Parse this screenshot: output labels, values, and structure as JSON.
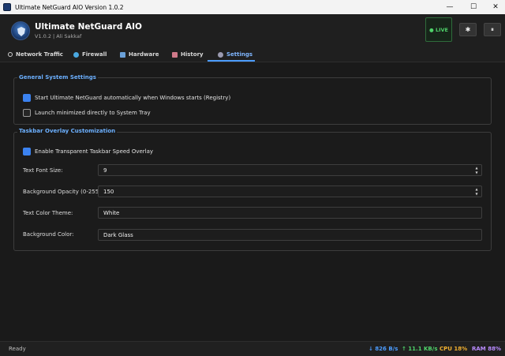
{
  "window": {
    "title": "Ultimate NetGuard AIO Version 1.0.2",
    "controls": {
      "minimize": "—",
      "maximize": "☐",
      "close": "✕"
    }
  },
  "header": {
    "app_name": "Ultimate NetGuard AIO",
    "subtitle": "V1.0.2 | Ali Sakkaf",
    "live_label": "● LIVE",
    "btn1_glyph": "✱",
    "btn2_glyph": "⏸",
    "live_color": "#4fd26a"
  },
  "tabs": [
    {
      "label": "Network Traffic",
      "icon": "circle-icon"
    },
    {
      "label": "Firewall",
      "icon": "firewall-icon"
    },
    {
      "label": "Hardware",
      "icon": "hardware-icon"
    },
    {
      "label": "History",
      "icon": "history-icon"
    },
    {
      "label": "Settings",
      "icon": "gear-icon",
      "active": true
    }
  ],
  "general": {
    "title": "General System Settings",
    "autostart": {
      "label": "Start Ultimate NetGuard automatically when Windows starts (Registry)",
      "checked": true
    },
    "minimized": {
      "label": "Launch minimized directly to System Tray",
      "checked": false
    }
  },
  "overlay": {
    "title": "Taskbar Overlay Customization",
    "enable": {
      "label": "Enable Transparent Taskbar Speed Overlay",
      "checked": true
    },
    "font_size": {
      "label": "Text Font Size:",
      "value": "9"
    },
    "opacity": {
      "label": "Background Opacity (0-255):",
      "value": "150"
    },
    "text_color": {
      "label": "Text Color Theme:",
      "value": "White"
    },
    "bg_color": {
      "label": "Background Color:",
      "value": "Dark Glass"
    }
  },
  "status": {
    "ready": "Ready",
    "download": "↓ 826 B/s",
    "upload": "↑ 11.1 KB/s",
    "cpu": "CPU 18%",
    "ram": "RAM 88%"
  },
  "colors": {
    "accent": "#4c9cff",
    "background": "#1a1a1a",
    "checkbox": "#3b82f0"
  }
}
